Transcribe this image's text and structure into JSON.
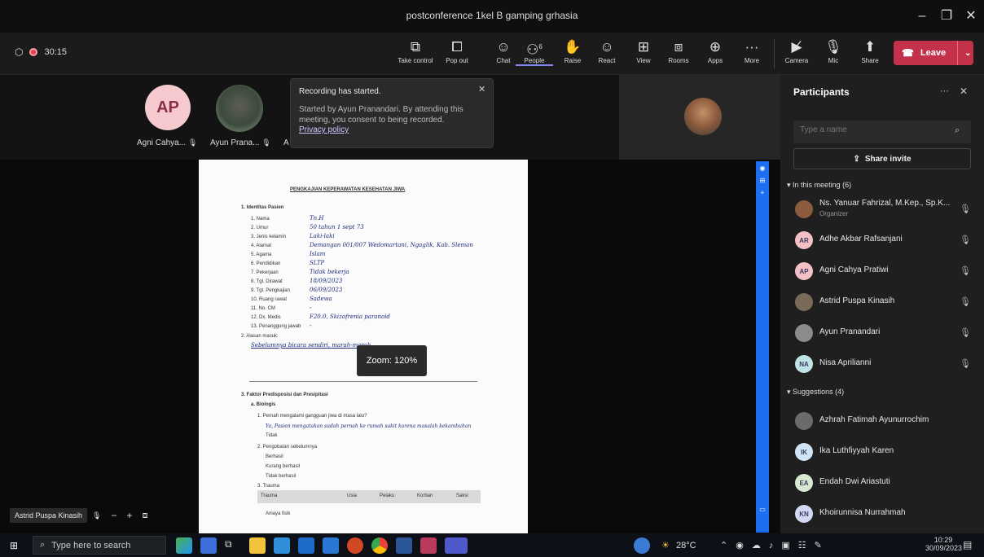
{
  "window": {
    "title": "postconference 1kel B gamping grhasia",
    "minimize": "–",
    "maximize": "❐",
    "close": "✕"
  },
  "status": {
    "timer": "30:15"
  },
  "toolbar": {
    "take_control": "Take control",
    "pop_out": "Pop out",
    "chat": "Chat",
    "people": "People",
    "people_count": "6",
    "raise": "Raise",
    "react": "React",
    "view": "View",
    "rooms": "Rooms",
    "apps": "Apps",
    "more": "More",
    "camera": "Camera",
    "mic": "Mic",
    "share": "Share",
    "leave": "Leave"
  },
  "stage": {
    "tiles": [
      {
        "initials": "AP",
        "name": "Agni Cahya..."
      },
      {
        "name": "Ayun Prana..."
      },
      {
        "name": "A"
      }
    ],
    "presenter_tile_name": "Astrid Puspa Kinasih",
    "zoom_label": "Zoom: 120%",
    "zoom_minus": "−",
    "zoom_plus": "+"
  },
  "toast": {
    "title": "Recording has started.",
    "body": "Started by Ayun Pranandari. By attending this meeting, you consent to being recorded.",
    "link": "Privacy policy"
  },
  "document": {
    "heading": "PENGKAJIAN KEPERAWATAN KESEHATAN JIWA",
    "section1": "1.  Identitas Pasien",
    "fields": [
      {
        "label": "1.  Nama",
        "value": "Tn.H"
      },
      {
        "label": "2.  Umur",
        "value": "50 tahun  1 sept 73"
      },
      {
        "label": "3.  Jenis kelamin",
        "value": "Laki-laki"
      },
      {
        "label": "4.  Alamat",
        "value": "Demangan 001/007 Wedomartani, Ngaglik, Kab. Sleman"
      },
      {
        "label": "5.  Agama",
        "value": "Islam"
      },
      {
        "label": "6.  Pendidikan",
        "value": "SLTP"
      },
      {
        "label": "7.  Pekerjaan",
        "value": "Tidak bekerja"
      },
      {
        "label": "8.  Tgl. Dirawat",
        "value": "18/09/2023"
      },
      {
        "label": "9.  Tgl. Pengkajian",
        "value": "06/09/2023"
      },
      {
        "label": "10. Ruang rawat",
        "value": "Sadewa"
      },
      {
        "label": "11. No. CM",
        "value": "-"
      },
      {
        "label": "12. Dx. Medis",
        "value": "F20.0, Skizofrenia paranoid"
      },
      {
        "label": "13. Penanggung jawab",
        "value": "-"
      }
    ],
    "section2": "2.  Alasan masuk:",
    "reason": "Sebelumnya bicara sendiri, marah-marah",
    "section3": "3.  Faktor Predisposisi dan Presipitasi",
    "biologi": "a.  Biologis",
    "q1": "1.  Pernah mengalami gangguan jiwa di masa lalu?",
    "a1": "Ya, Pasien mengatakan sudah pernah ke rumah sakit karena masalah kekambuhan",
    "no1": "Tidak",
    "q2": "2.  Pengobatan sebelumnya",
    "o2a": "Berhasil",
    "o2b": "Kurang berhasil",
    "o2c": "Tidak berhasil",
    "q3": "3.  Trauma",
    "table_headers": [
      "Trauma",
      "Usia",
      "Pelaku",
      "Korban",
      "Saksi"
    ],
    "table_row": "Aniaya fisik"
  },
  "sidebar": {
    "title": "Participants",
    "more": "···",
    "close": "✕",
    "search_placeholder": "Type a name",
    "share_invite": "Share invite",
    "in_meeting_header": "In this meeting (6)",
    "in_meeting": [
      {
        "name": "Ns. Yanuar Fahrizal, M.Kep., Sp.K...",
        "role": "Organizer",
        "initials": "",
        "color": "#8a5b3c"
      },
      {
        "name": "Adhe Akbar Rafsanjani",
        "initials": "AR",
        "color": "#f3c0c6"
      },
      {
        "name": "Agni Cahya Pratiwi",
        "initials": "AP",
        "color": "#f3c0c6"
      },
      {
        "name": "Astrid Puspa Kinasih",
        "initials": "",
        "color": "#7a6a5a"
      },
      {
        "name": "Ayun Pranandari",
        "initials": "",
        "color": "#8c8c8c"
      },
      {
        "name": "Nisa Aprilianni",
        "initials": "NA",
        "color": "#bfe3e6"
      }
    ],
    "suggestions_header": "Suggestions (4)",
    "suggestions": [
      {
        "name": "Azhrah Fatimah Ayunurrochim",
        "initials": "",
        "color": "#6b6b6b"
      },
      {
        "name": "Ika Luthfiyyah Karen",
        "initials": "IK",
        "color": "#cfe5f5"
      },
      {
        "name": "Endah Dwi Ariastuti",
        "initials": "EA",
        "color": "#d6ead2"
      },
      {
        "name": "Khoirunnisa Nurrahmah",
        "initials": "KN",
        "color": "#d2d8f3"
      }
    ]
  },
  "taskbar": {
    "search_placeholder": "Type here to search",
    "weather": "28°C",
    "time": "10:29",
    "date": "30/09/2023"
  }
}
